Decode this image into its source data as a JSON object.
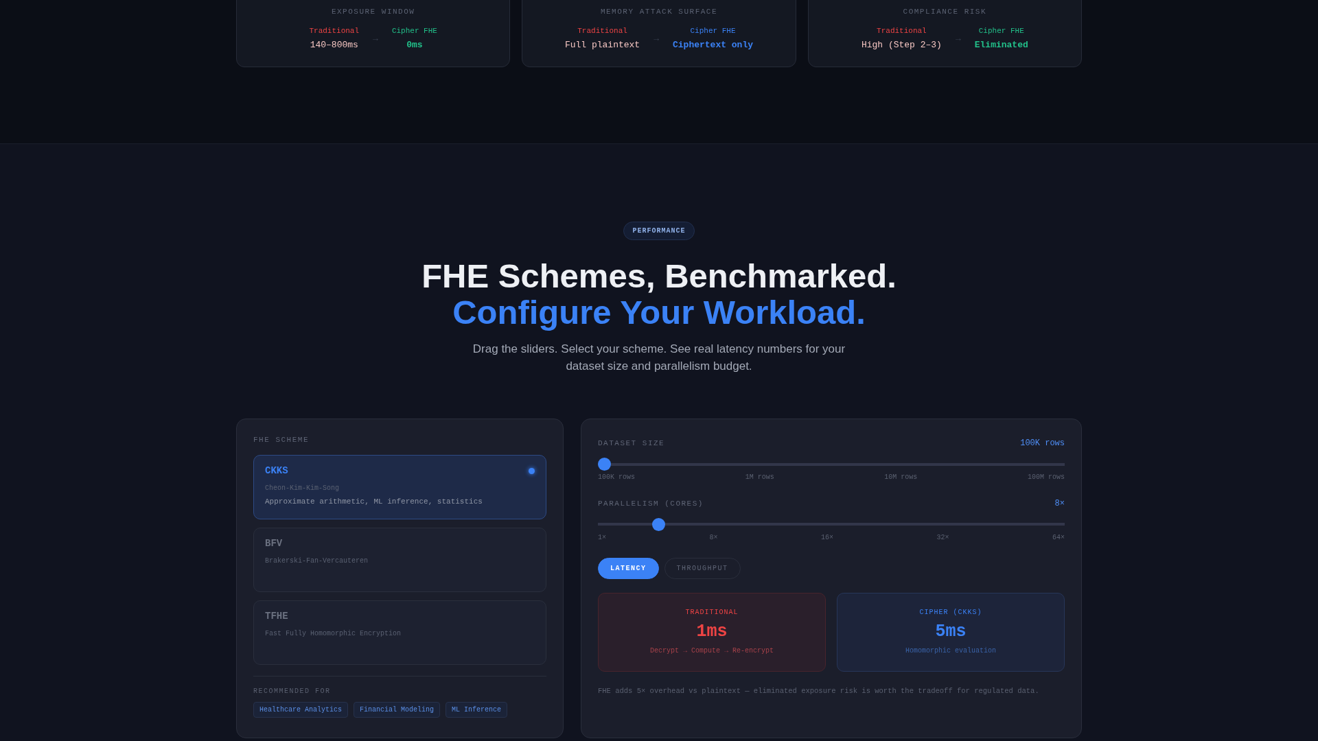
{
  "comparison_cards": [
    {
      "title": "EXPOSURE WINDOW",
      "traditional_label": "Traditional",
      "traditional_value": "140–800ms",
      "arrow": "→",
      "cipher_label": "Cipher FHE",
      "cipher_value": "0ms",
      "color": "#22c08a"
    },
    {
      "title": "MEMORY ATTACK SURFACE",
      "traditional_label": "Traditional",
      "traditional_value": "Full plaintext",
      "arrow": "→",
      "cipher_label": "Cipher FHE",
      "cipher_value": "Ciphertext only",
      "color": "#3b82f6"
    },
    {
      "title": "COMPLIANCE RISK",
      "traditional_label": "Traditional",
      "traditional_value": "High (Step 2–3)",
      "arrow": "→",
      "cipher_label": "Cipher FHE",
      "cipher_value": "Eliminated",
      "color": "#22c08a"
    }
  ],
  "section": {
    "badge": "PERFORMANCE",
    "title_line_1": "FHE Schemes, Benchmarked.",
    "title_line_2": "Configure Your Workload.",
    "subtitle": "Drag the sliders. Select your scheme. See real latency numbers for your dataset size and parallelism budget."
  },
  "scheme_panel": {
    "label": "FHE SCHEME",
    "schemes": [
      {
        "name": "CKKS",
        "full_name": "Cheon-Kim-Kim-Song",
        "description": "Approximate arithmetic, ML inference, statistics",
        "selected": true
      },
      {
        "name": "BFV",
        "full_name": "Brakerski-Fan-Vercauteren",
        "selected": false
      },
      {
        "name": "TFHE",
        "full_name": "Fast Fully Homomorphic Encryption",
        "selected": false
      }
    ],
    "recommended_label": "RECOMMENDED FOR",
    "tags": [
      "Healthcare Analytics",
      "Financial Modeling",
      "ML Inference"
    ]
  },
  "config_panel": {
    "sliders": [
      {
        "label": "DATASET SIZE",
        "reading": "100K rows",
        "level": 0,
        "ticks": [
          "100K rows",
          "1M rows",
          "10M rows",
          "100M rows"
        ]
      },
      {
        "label": "PARALLELISM (CORES)",
        "reading": "8×",
        "level": 0.12,
        "ticks": [
          "1×",
          "8×",
          "16×",
          "32×",
          "64×"
        ]
      }
    ],
    "modes": [
      {
        "label": "LATENCY",
        "selected": true
      },
      {
        "label": "THROUGHPUT",
        "selected": false
      }
    ],
    "results": [
      {
        "kind": "traditional",
        "label": "TRADITIONAL",
        "value": "1ms",
        "detail": "Decrypt → Compute → Re-encrypt"
      },
      {
        "kind": "cipher",
        "label": "CIPHER (CKKS)",
        "value": "5ms",
        "detail": "Homomorphic evaluation"
      }
    ],
    "note": "FHE adds 5× overhead vs plaintext — eliminated exposure risk is worth the tradeoff for regulated data."
  }
}
